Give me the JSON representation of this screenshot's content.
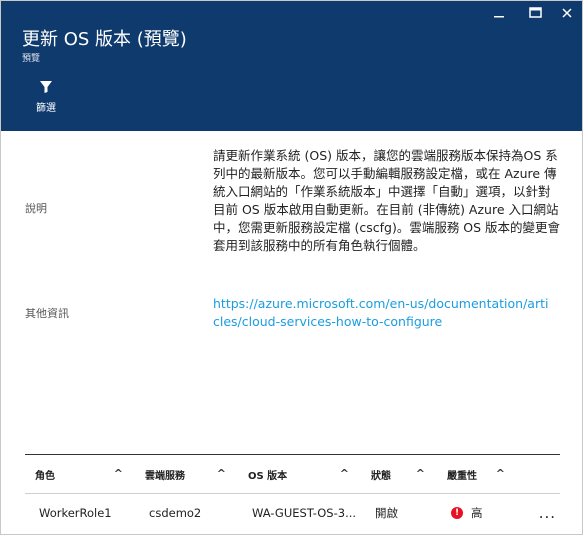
{
  "window": {
    "minimize_icon": "minimize-icon",
    "maximize_icon": "maximize-icon",
    "close_icon": "close-icon"
  },
  "header": {
    "title": "更新 OS 版本 (預覽)",
    "subtitle": "預覽",
    "bg_color": "#0e3a6e"
  },
  "toolbar": {
    "filter_label": "篩選",
    "filter_icon": "filter-icon"
  },
  "details": {
    "description_label": "說明",
    "description_text": "請更新作業系統 (OS) 版本，讓您的雲端服務版本保持為OS 系列中的最新版本。您可以手動編輯服務設定檔，或在 Azure 傳統入口網站的「作業系統版本」中選擇「自動」選項，以針對目前 OS 版本啟用自動更新。在目前 (非傳統) Azure 入口網站中，您需更新服務設定檔 (cscfg)。雲端服務 OS 版本的變更會套用到該服務中的所有角色執行個體。",
    "more_info_label": "其他資訊",
    "more_info_link": "https://azure.microsoft.com/en-us/documentation/articles/cloud-services-how-to-configure",
    "link_color": "#1a9de0"
  },
  "table": {
    "columns": [
      "角色",
      "雲端服務",
      "OS 版本",
      "狀態",
      "嚴重性"
    ],
    "rows": [
      {
        "role": "WorkerRole1",
        "service": "csdemo2",
        "os_version": "WA-GUEST-OS-3...",
        "status": "開啟",
        "severity": "高",
        "severity_color": "#e81123"
      }
    ],
    "more_label": "..."
  }
}
